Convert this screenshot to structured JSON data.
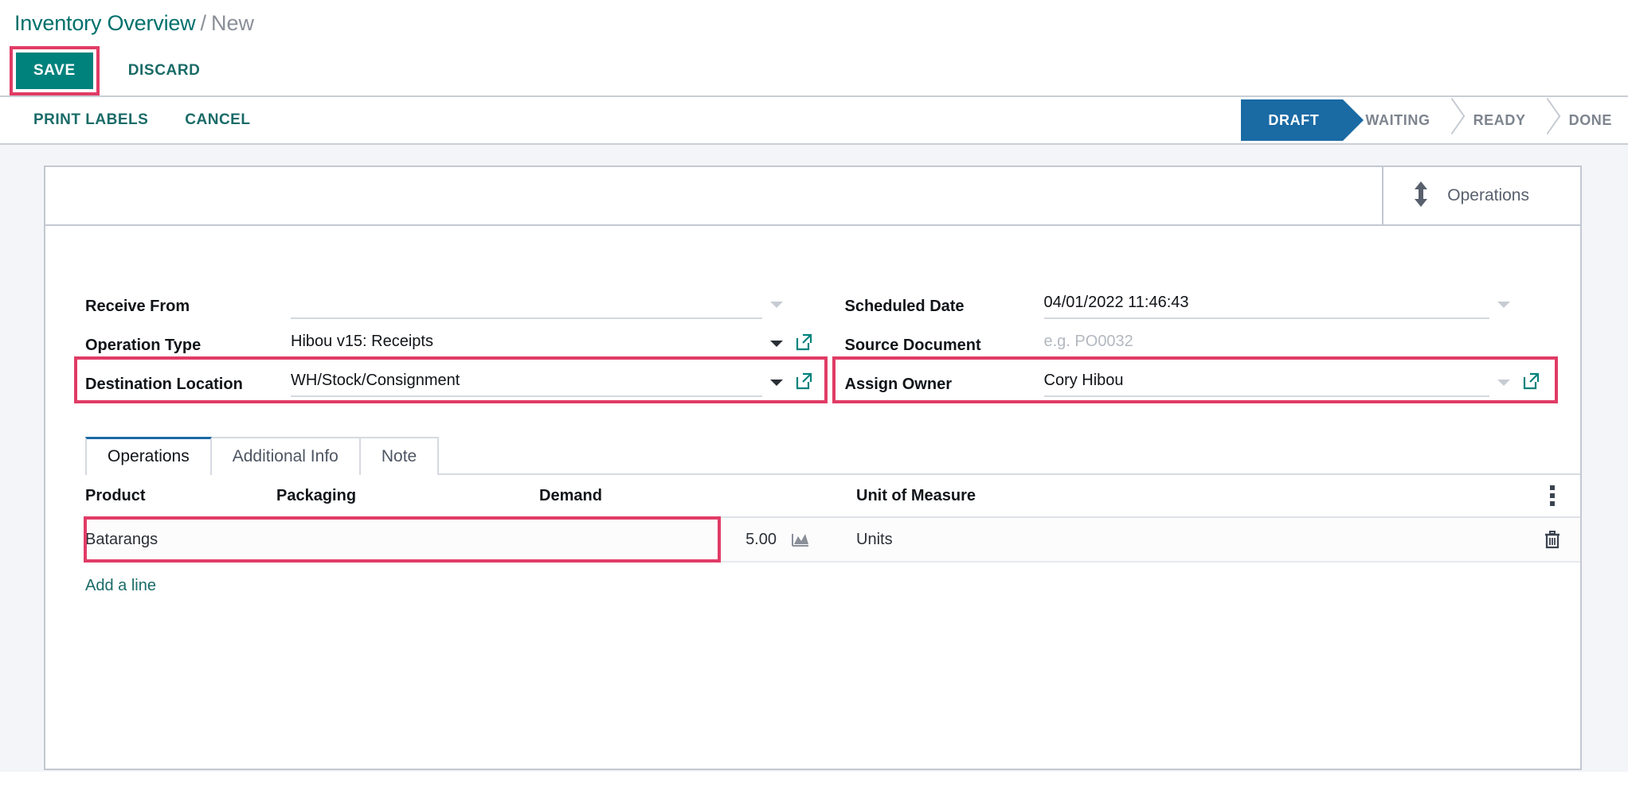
{
  "breadcrumb": {
    "root": "Inventory Overview",
    "separator": "/",
    "current": "New"
  },
  "save_bar": {
    "save_label": "SAVE",
    "discard_label": "DISCARD"
  },
  "control_panel": {
    "actions": [
      {
        "label": "PRINT LABELS",
        "name": "print-labels-button"
      },
      {
        "label": "CANCEL",
        "name": "cancel-button"
      }
    ],
    "statusbar": {
      "stages": [
        "DRAFT",
        "WAITING",
        "READY",
        "DONE"
      ],
      "active": "DRAFT",
      "active_color": "#1a6aa4"
    }
  },
  "smart_buttons": [
    {
      "label": "Operations",
      "icon": "arrows-up-down-icon"
    }
  ],
  "form": {
    "left": [
      {
        "label": "Receive From",
        "value": "",
        "placeholder": "",
        "has_caret": true,
        "caret_style": "light",
        "has_external_link": false,
        "underline": true,
        "highlighted": false
      },
      {
        "label": "Operation Type",
        "value": "Hibou v15: Receipts",
        "placeholder": "",
        "has_caret": true,
        "caret_style": "dark",
        "has_external_link": true,
        "underline": true,
        "highlighted": false
      },
      {
        "label": "Destination Location",
        "value": "WH/Stock/Consignment",
        "placeholder": "",
        "has_caret": true,
        "caret_style": "dark",
        "has_external_link": true,
        "underline": true,
        "highlighted": true
      }
    ],
    "right": [
      {
        "label": "Scheduled Date",
        "value": "04/01/2022 11:46:43",
        "placeholder": "",
        "has_caret": true,
        "caret_style": "light",
        "has_external_link": false,
        "underline": true,
        "highlighted": false
      },
      {
        "label": "Source Document",
        "value": "",
        "placeholder": "e.g. PO0032",
        "has_caret": false,
        "caret_style": "light",
        "has_external_link": false,
        "underline": false,
        "highlighted": false
      },
      {
        "label": "Assign Owner",
        "value": "Cory Hibou",
        "placeholder": "",
        "has_caret": true,
        "caret_style": "light",
        "has_external_link": true,
        "underline": true,
        "highlighted": true
      }
    ]
  },
  "notebook": {
    "tabs": [
      {
        "label": "Operations",
        "active": true
      },
      {
        "label": "Additional Info",
        "active": false
      },
      {
        "label": "Note",
        "active": false
      }
    ]
  },
  "operations_list": {
    "columns": [
      "Product",
      "Packaging",
      "Demand",
      "Unit of Measure"
    ],
    "rows": [
      {
        "product": "Batarangs",
        "packaging": "",
        "demand": "5.00",
        "demand_icon": "forecast-chart-icon",
        "uom": "Units",
        "delete_icon": "trash-icon",
        "highlighted": true
      }
    ],
    "optional_columns_icon": "vertical-ellipsis-icon",
    "add_line_label": "Add a line"
  },
  "colors": {
    "brand_teal": "#00827c",
    "link_teal": "#1a6b68",
    "highlight_pink": "#e03c66",
    "stage_blue": "#1a6aa4",
    "muted_gray": "#8a8f98"
  }
}
